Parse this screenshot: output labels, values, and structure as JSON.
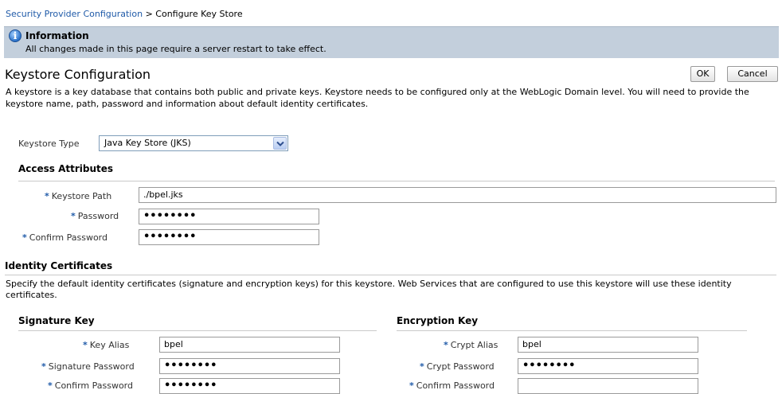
{
  "breadcrumb": {
    "parent": "Security Provider Configuration",
    "separator": ">",
    "current": "Configure Key Store"
  },
  "info": {
    "icon": "info-icon",
    "title": "Information",
    "message": "All changes made in this page require a server restart to take effect."
  },
  "page": {
    "title": "Keystore Configuration",
    "description": "A keystore is a key database that contains both public and private keys. Keystore needs to be configured only at the WebLogic Domain level. You will need to provide the keystore name, path, password and information about default identity certificates."
  },
  "buttons": {
    "ok": "OK",
    "cancel": "Cancel"
  },
  "keystore_type": {
    "label": "Keystore Type",
    "selected": "Java Key Store (JKS)",
    "icon": "chevron-down-icon"
  },
  "access": {
    "heading": "Access Attributes",
    "required_mark": "*",
    "keystore_path_label": "Keystore Path",
    "keystore_path_value": "./bpel.jks",
    "password_label": "Password",
    "password_value": "••••••••",
    "confirm_label": "Confirm Password",
    "confirm_value": "••••••••"
  },
  "identity": {
    "heading": "Identity Certificates",
    "description": "Specify the default identity certificates (signature and encryption keys) for this keystore. Web Services that are configured to use this keystore will use these identity certificates."
  },
  "signature": {
    "heading": "Signature Key",
    "alias_label": "Key Alias",
    "alias_value": "bpel",
    "password_label": "Signature Password",
    "password_value": "••••••••",
    "confirm_label": "Confirm Password",
    "confirm_value": "••••••••"
  },
  "encryption": {
    "heading": "Encryption Key",
    "alias_label": "Crypt Alias",
    "alias_value": "bpel",
    "password_label": "Crypt Password",
    "password_value": "••••••••",
    "confirm_label": "Confirm Password",
    "confirm_value": ""
  },
  "colors": {
    "link": "#1f5aa8",
    "info_bar": "#c3cfdc",
    "required": "#1f5aa8"
  }
}
